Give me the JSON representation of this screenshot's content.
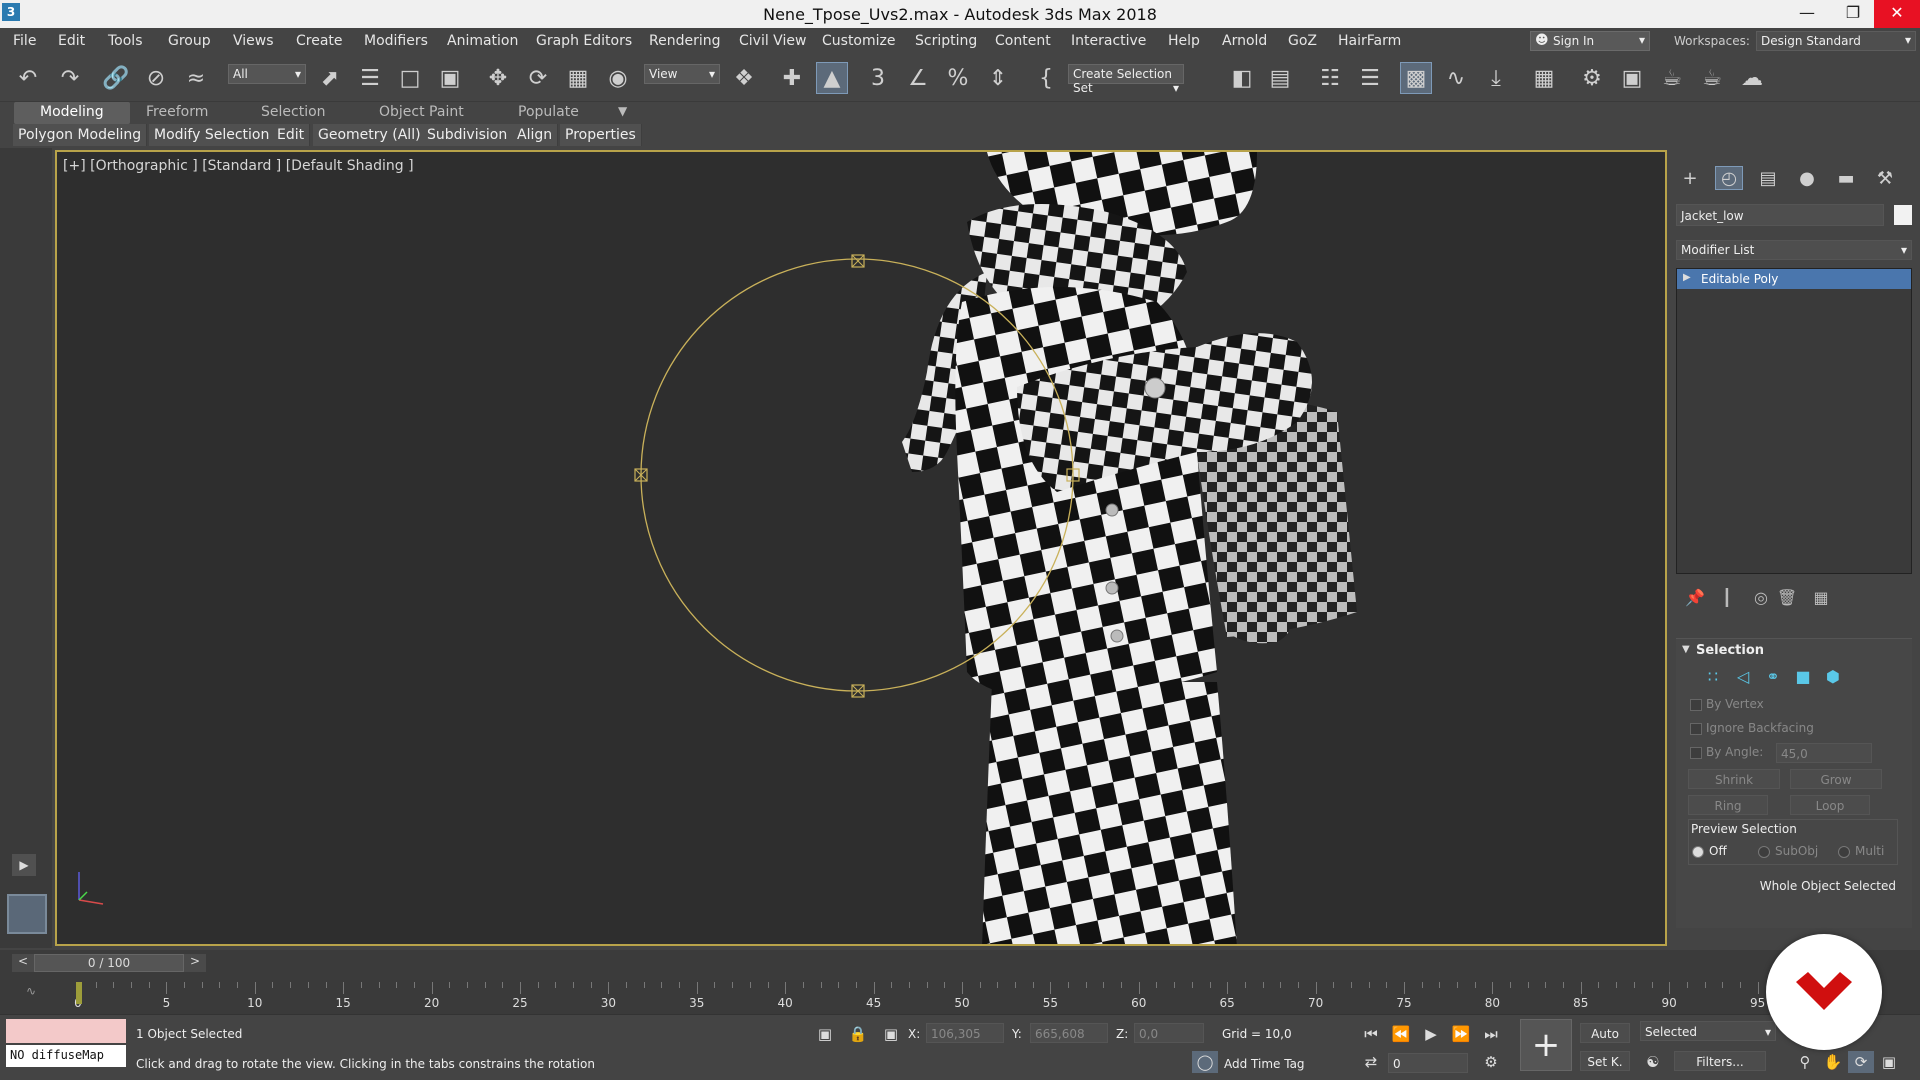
{
  "window": {
    "title": "Nene_Tpose_Uvs2.max - Autodesk 3ds Max 2018",
    "app_icon": "3",
    "controls": [
      "minimize-icon",
      "restore-icon",
      "close-icon"
    ]
  },
  "menu": {
    "items": [
      "File",
      "Edit",
      "Tools",
      "Group",
      "Views",
      "Create",
      "Modifiers",
      "Animation",
      "Graph Editors",
      "Rendering",
      "Civil View",
      "Customize",
      "Scripting",
      "Content",
      "Interactive",
      "Help",
      "Arnold",
      "GoZ",
      "HairFarm"
    ],
    "sign_in": "Sign In",
    "workspaces_label": "Workspaces:",
    "workspace_value": "Design Standard"
  },
  "toolbar": {
    "filter_value": "All",
    "reference_coord_value": "View",
    "named_selection_placeholder": "Create Selection Set",
    "icons": [
      "undo-icon",
      "redo-icon",
      "link-icon",
      "unlink-icon",
      "bind-spacewarp-icon",
      "select-object-icon",
      "select-by-name-icon",
      "rect-selection-icon",
      "window-crossing-icon",
      "move-icon",
      "rotate-icon",
      "scale-icon",
      "place-icon",
      "pivot-icon",
      "keyboard-shortcut-icon",
      "snap-3d-icon",
      "angle-snap-icon",
      "percent-snap-icon",
      "spinner-snap-icon",
      "edit-named-selection-icon",
      "mirror-icon",
      "align-icon",
      "scene-explorer-icon",
      "layer-explorer-icon",
      "ribbon-toggle-icon",
      "curve-editor-icon",
      "schematic-view-icon",
      "material-editor-icon",
      "render-setup-icon",
      "rendered-frame-icon",
      "render-production-icon",
      "render-iterative-icon",
      "render-cloud-icon"
    ]
  },
  "ribbon": {
    "tabs": [
      "Modeling",
      "Freeform",
      "Selection",
      "Object Paint",
      "Populate"
    ],
    "active_tab": "Modeling",
    "panels": [
      "Polygon Modeling",
      "Modify Selection",
      "Edit",
      "Geometry (All)",
      "Subdivision",
      "Align",
      "Properties"
    ]
  },
  "viewport": {
    "label": "[+] [Orthographic ] [Standard ] [Default Shading ]",
    "border_color": "#b8a34a",
    "gizmo_color": "#c9b15a"
  },
  "command_panel": {
    "object_name": "Jacket_low",
    "object_color": "#f2f2f2",
    "modifier_list": "Modifier List",
    "stack_item": "Editable Poly",
    "selection_rollout": {
      "title": "Selection",
      "by_vertex": "By Vertex",
      "ignore_backfacing": "Ignore Backfacing",
      "by_angle": "By Angle:",
      "angle_value": "45,0",
      "shrink": "Shrink",
      "grow": "Grow",
      "ring": "Ring",
      "loop": "Loop",
      "preview_selection": "Preview Selection",
      "preview_off": "Off",
      "preview_subobj": "SubObj",
      "preview_multi": "Multi",
      "status": "Whole Object Selected"
    }
  },
  "timeline": {
    "frame_display": "0 / 100",
    "prev": "<",
    "next": ">",
    "current_frame": 0,
    "ticks": [
      "0",
      "5",
      "10",
      "15",
      "20",
      "25",
      "30",
      "35",
      "40",
      "45",
      "50",
      "55",
      "60",
      "65",
      "70",
      "75",
      "80",
      "85",
      "90",
      "95"
    ]
  },
  "status": {
    "maxscript_text": "NO diffuseMap",
    "selection_count": "1 Object Selected",
    "prompt": "Click and drag to rotate the view.  Clicking in the tabs constrains the rotation",
    "x_label": "X:",
    "x_value": "106,305",
    "y_label": "Y:",
    "y_value": "665,608",
    "z_label": "Z:",
    "z_value": "0,0",
    "grid": "Grid = 10,0",
    "add_time_tag": "Add Time Tag",
    "auto": "Auto",
    "set_key": "Set K.",
    "selected_dropdown": "Selected",
    "filters": "Filters...",
    "frame_field": "0"
  }
}
